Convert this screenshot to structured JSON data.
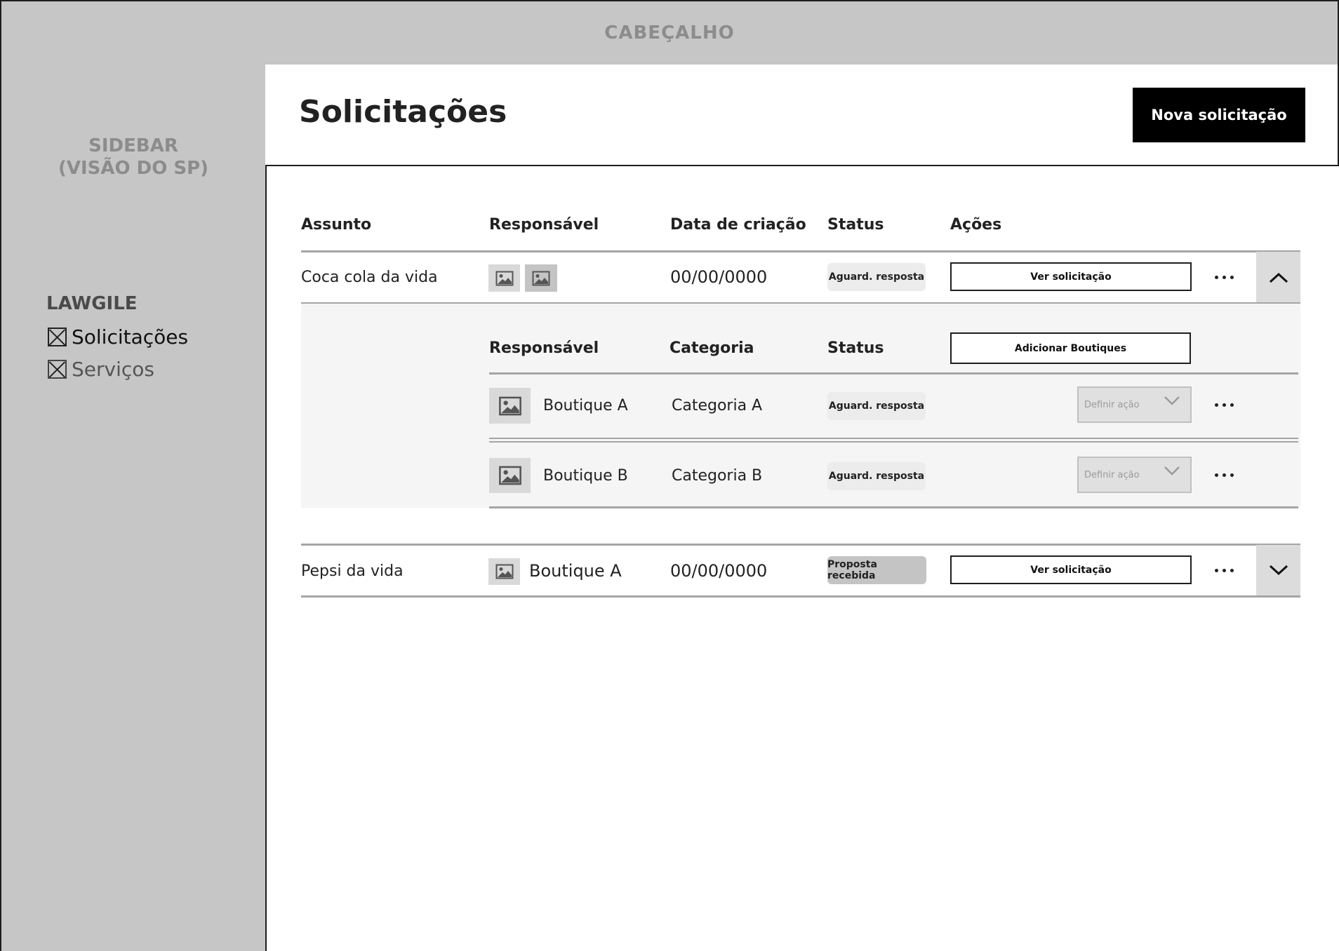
{
  "header": {
    "label": "CABEÇALHO"
  },
  "sidebar": {
    "title_line1": "SIDEBAR",
    "title_line2": "(VISÃO DO SP)",
    "brand": "LAWGILE",
    "items": [
      {
        "label": "Solicitações",
        "active": true
      },
      {
        "label": "Serviços",
        "active": false
      }
    ]
  },
  "page": {
    "title": "Solicitações",
    "new_button": "Nova solicitação"
  },
  "table": {
    "columns": [
      "Assunto",
      "Responsável",
      "Data de criação",
      "Status",
      "Ações"
    ],
    "rows": [
      {
        "subject": "Coca cola da vida",
        "responsible_name": "",
        "date": "00/00/0000",
        "status": "Aguard. resposta",
        "action": "Ver solicitação",
        "expanded": true
      },
      {
        "subject": "Pepsi da vida",
        "responsible_name": "Boutique A",
        "date": "00/00/0000",
        "status": "Proposta recebida",
        "action": "Ver solicitação",
        "expanded": false
      }
    ]
  },
  "subtable": {
    "columns": [
      "Responsável",
      "Categoria",
      "Status"
    ],
    "add_button": "Adicionar Boutiques",
    "rows": [
      {
        "name": "Boutique A",
        "category": "Categoria A",
        "status": "Aguard. resposta",
        "select_placeholder": "Definir ação"
      },
      {
        "name": "Boutique B",
        "category": "Categoria B",
        "status": "Aguard. resposta",
        "select_placeholder": "Definir ação"
      }
    ]
  },
  "icons": {
    "image": "image-placeholder-icon",
    "more": "more-horizontal-icon",
    "chevron_up": "chevron-up-icon",
    "chevron_down": "chevron-down-icon",
    "nav": "x-box-icon"
  }
}
